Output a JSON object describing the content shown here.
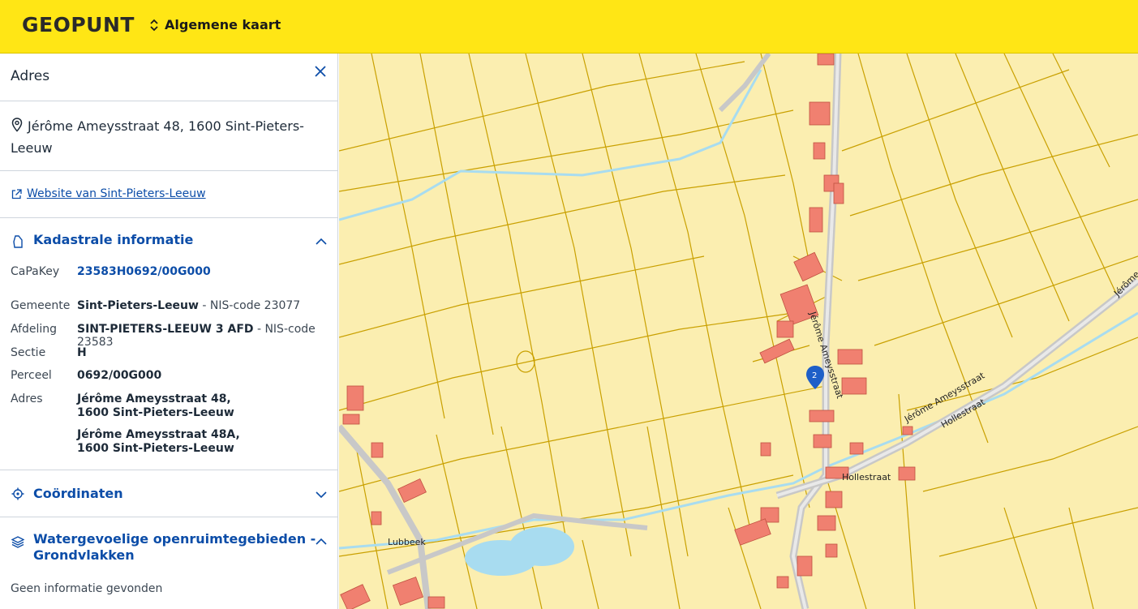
{
  "header": {
    "brand": "GEOPUNT",
    "map_selector_label": "Algemene kaart"
  },
  "panel": {
    "title": "Adres",
    "address": "Jérôme Ameysstraat 48, 1600 Sint-Pieters-Leeuw",
    "website_link": "Website van Sint-Pieters-Leeuw",
    "kadastraal": {
      "title": "Kadastrale informatie",
      "rows": [
        {
          "label": "CaPaKey",
          "value": "23583H0692/00G000"
        },
        {
          "label": "Gemeente",
          "value": "Sint-Pieters-Leeuw",
          "extra": " - NIS-code 23077"
        },
        {
          "label": "Afdeling",
          "value": "SINT-PIETERS-LEEUW 3 AFD",
          "extra": " - NIS-code 23583"
        },
        {
          "label": "Sectie",
          "value": "H"
        },
        {
          "label": "Perceel",
          "value": "0692/00G000"
        },
        {
          "label": "Adres",
          "value": "Jérôme Ameysstraat 48,",
          "value2": "1600 Sint-Pieters-Leeuw",
          "value3": "Jérôme Ameysstraat 48A,",
          "value4": "1600 Sint-Pieters-Leeuw"
        }
      ]
    },
    "coordinaten": {
      "title": "Coördinaten"
    },
    "water": {
      "title_line1": "Watergevoelige openruimtegebieden -",
      "title_line2": "Grondvlakken",
      "empty_text": "Geen informatie gevonden"
    }
  },
  "map": {
    "marker_label": "2",
    "street_labels": [
      "Jérôme Ameysstraat",
      "Jérôme Ameysstraat",
      "Hollestraat",
      "Hollestraat",
      "Lubbeek",
      "Jérôme"
    ],
    "colors": {
      "parcel_fill": "#fbeeb0",
      "parcel_line": "#c9a000",
      "building": "#f08070",
      "road": "#c8c8c8",
      "water": "#a8dcf0",
      "marker": "#1e5fc8"
    }
  }
}
